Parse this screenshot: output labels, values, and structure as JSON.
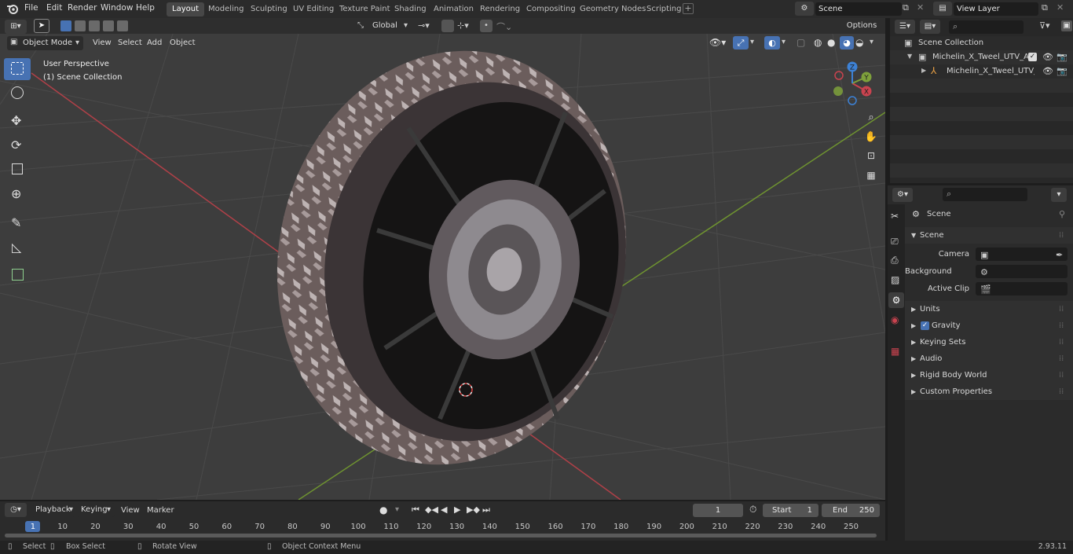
{
  "menu": [
    "File",
    "Edit",
    "Render",
    "Window",
    "Help"
  ],
  "workspaces": [
    "Layout",
    "Modeling",
    "Sculpting",
    "UV Editing",
    "Texture Paint",
    "Shading",
    "Animation",
    "Rendering",
    "Compositing",
    "Geometry Nodes",
    "Scripting"
  ],
  "scene_field": "Scene",
  "view_layer_field": "View Layer",
  "viewport_header": {
    "mode": "Object Mode",
    "menus": [
      "View",
      "Select",
      "Add",
      "Object"
    ],
    "transform_orientation": "Global",
    "options": "Options"
  },
  "viewport": {
    "perspective_label": "User Perspective",
    "collection_label": "(1) Scene Collection",
    "gizmo_axes": {
      "x": "X",
      "y": "Y",
      "z": "Z"
    }
  },
  "outliner": {
    "root": "Scene Collection",
    "items": [
      "Michelin_X_Tweel_UTV_Airles",
      "Michelin_X_Tweel_UTV_A"
    ]
  },
  "properties": {
    "context": "Scene",
    "panel": "Scene",
    "camera_label": "Camera",
    "background_scene_label": "Background Scene",
    "active_clip_label": "Active Clip",
    "subpanels": [
      "Units",
      "Gravity",
      "Keying Sets",
      "Audio",
      "Rigid Body World",
      "Custom Properties"
    ]
  },
  "timeline": {
    "menus": [
      "Playback",
      "Keying",
      "View",
      "Marker"
    ],
    "current_frame": "1",
    "start_label": "Start",
    "start_value": "1",
    "end_label": "End",
    "end_value": "250",
    "ticks": [
      "1",
      "10",
      "20",
      "30",
      "40",
      "50",
      "60",
      "70",
      "80",
      "90",
      "100",
      "110",
      "120",
      "130",
      "140",
      "150",
      "160",
      "170",
      "180",
      "190",
      "200",
      "210",
      "220",
      "230",
      "240",
      "250"
    ]
  },
  "status": {
    "select": "Select",
    "box_select": "Box Select",
    "rotate_view": "Rotate View",
    "context_menu": "Object Context Menu",
    "version": "2.93.11"
  },
  "colors": {
    "accent": "#4772b3",
    "x_axis": "#c9434f",
    "y_axis": "#7ea13b",
    "z_axis": "#3d82d6"
  }
}
